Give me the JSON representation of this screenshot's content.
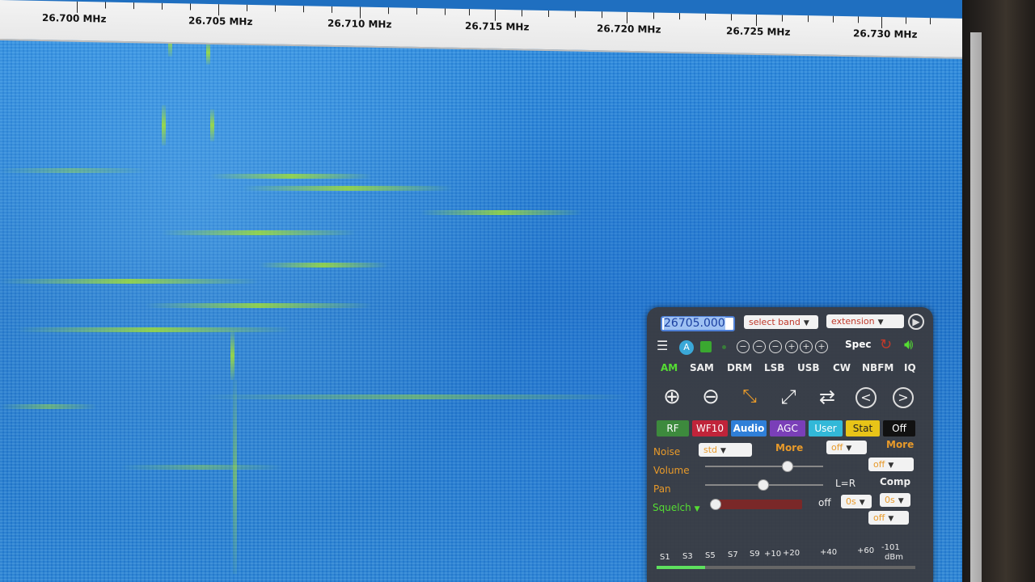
{
  "frequency_scale": {
    "labels": [
      "26.700 MHz",
      "26.705 MHz",
      "26.710 MHz",
      "26.715 MHz",
      "26.720 MHz",
      "26.725 MHz",
      "26.730 MHz"
    ]
  },
  "control_panel": {
    "frequency_value": "26705.000",
    "band_select": "select band",
    "extension_select": "extension",
    "spec_label": "Spec",
    "modes": [
      "AM",
      "SAM",
      "DRM",
      "LSB",
      "USB",
      "CW",
      "NBFM",
      "IQ"
    ],
    "active_mode": "AM",
    "tabs": [
      "RF",
      "WF10",
      "Audio",
      "AGC",
      "User",
      "Stat",
      "Off"
    ],
    "colors": {
      "tab_rf": "#3d8a3d",
      "tab_wf": "#c0243a",
      "tab_audio": "#2f7fd8",
      "tab_agc": "#7a3fb8",
      "tab_user": "#32b8d8",
      "tab_stat": "#e8c418",
      "tab_off": "#111111",
      "accent_orange": "#e89a2a",
      "mode_active": "#55dd33"
    },
    "noise_label": "Noise",
    "noise_select": "std",
    "more_label": "More",
    "nr_select": "off",
    "more2_label": "More",
    "volume_label": "Volume",
    "volume_select": "off",
    "pan_label": "Pan",
    "pan_value": "L=R",
    "comp_label": "Comp",
    "squelch_label": "Squelch",
    "squelch_value": "off",
    "squelch_tail_1": "0s",
    "squelch_tail_2": "0s",
    "squelch_select": "off",
    "smeter_labels": [
      "S1",
      "S3",
      "S5",
      "S7",
      "S9",
      "+10",
      "+20",
      "+40",
      "+60"
    ],
    "smeter_dbm_value": "-101",
    "smeter_dbm_unit": "dBm"
  }
}
